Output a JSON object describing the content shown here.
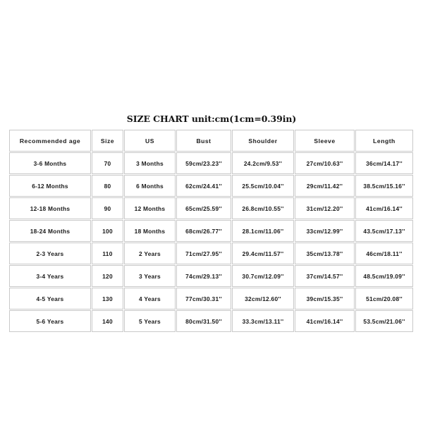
{
  "title": "SIZE CHART unit:cm(1cm=0.39in)",
  "chart_data": {
    "type": "table",
    "title": "SIZE CHART unit:cm(1cm=0.39in)",
    "columns": [
      "Recommended age",
      "Size",
      "US",
      "Bust",
      "Shoulder",
      "Sleeve",
      "Length"
    ],
    "rows": [
      [
        "3-6 Months",
        "70",
        "3 Months",
        "59cm/23.23''",
        "24.2cm/9.53''",
        "27cm/10.63''",
        "36cm/14.17''"
      ],
      [
        "6-12 Months",
        "80",
        "6 Months",
        "62cm/24.41''",
        "25.5cm/10.04''",
        "29cm/11.42''",
        "38.5cm/15.16''"
      ],
      [
        "12-18 Months",
        "90",
        "12 Months",
        "65cm/25.59''",
        "26.8cm/10.55''",
        "31cm/12.20''",
        "41cm/16.14''"
      ],
      [
        "18-24 Months",
        "100",
        "18 Months",
        "68cm/26.77''",
        "28.1cm/11.06''",
        "33cm/12.99''",
        "43.5cm/17.13''"
      ],
      [
        "2-3 Years",
        "110",
        "2 Years",
        "71cm/27.95''",
        "29.4cm/11.57''",
        "35cm/13.78''",
        "46cm/18.11''"
      ],
      [
        "3-4 Years",
        "120",
        "3 Years",
        "74cm/29.13''",
        "30.7cm/12.09''",
        "37cm/14.57''",
        "48.5cm/19.09''"
      ],
      [
        "4-5 Years",
        "130",
        "4 Years",
        "77cm/30.31''",
        "32cm/12.60''",
        "39cm/15.35''",
        "51cm/20.08''"
      ],
      [
        "5-6 Years",
        "140",
        "5 Years",
        "80cm/31.50''",
        "33.3cm/13.11''",
        "41cm/16.14''",
        "53.5cm/21.06''"
      ]
    ]
  },
  "colors": {
    "background": "#ffffff",
    "border": "#c9c9c9",
    "text": "#1a1a1a"
  }
}
